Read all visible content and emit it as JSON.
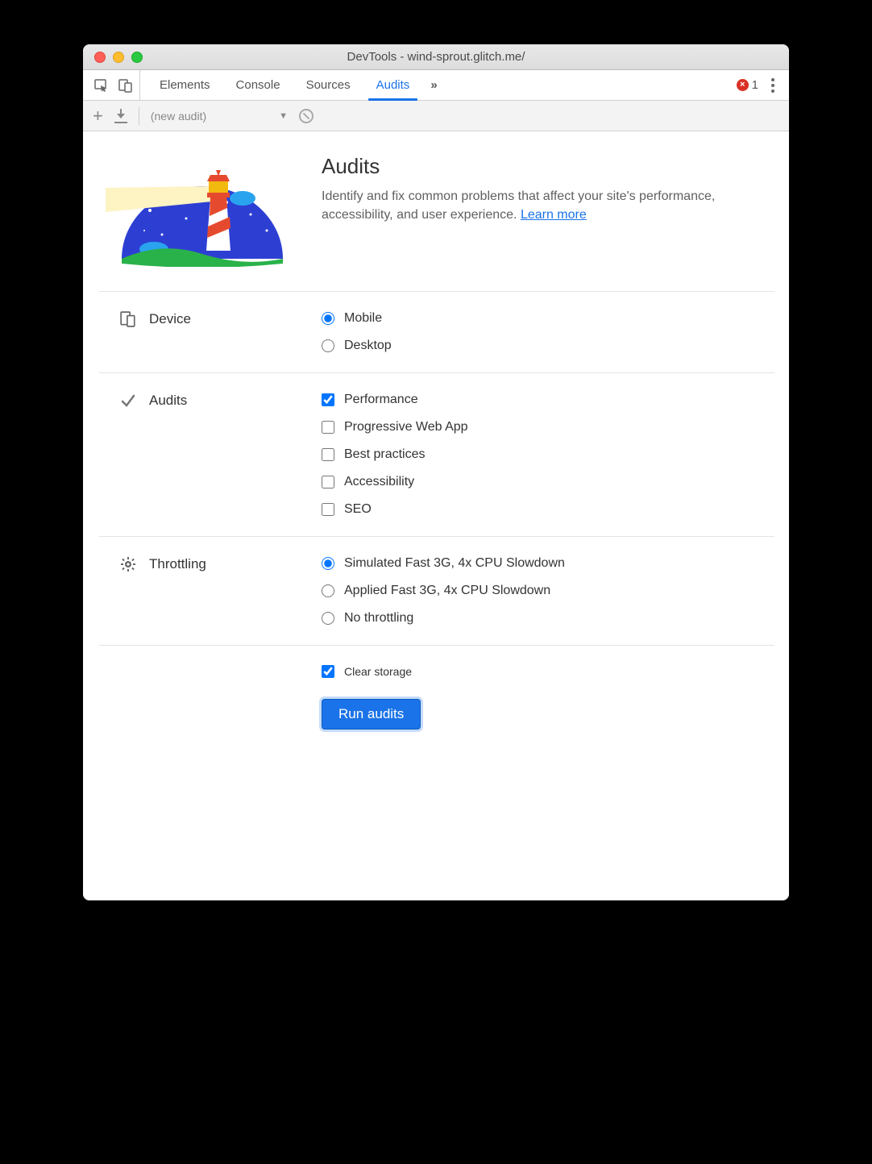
{
  "window": {
    "title": "DevTools - wind-sprout.glitch.me/"
  },
  "tabs": {
    "items": [
      {
        "label": "Elements",
        "active": false
      },
      {
        "label": "Console",
        "active": false
      },
      {
        "label": "Sources",
        "active": false
      },
      {
        "label": "Audits",
        "active": true
      }
    ],
    "errors_count": "1"
  },
  "subbar": {
    "dropdown_label": "(new audit)"
  },
  "intro": {
    "title": "Audits",
    "desc_prefix": "Identify and fix common problems that affect your site's performance, accessibility, and user experience. ",
    "learn_more": "Learn more"
  },
  "sections": {
    "device": {
      "title": "Device",
      "options": [
        {
          "label": "Mobile",
          "checked": true
        },
        {
          "label": "Desktop",
          "checked": false
        }
      ]
    },
    "audits": {
      "title": "Audits",
      "options": [
        {
          "label": "Performance",
          "checked": true
        },
        {
          "label": "Progressive Web App",
          "checked": false
        },
        {
          "label": "Best practices",
          "checked": false
        },
        {
          "label": "Accessibility",
          "checked": false
        },
        {
          "label": "SEO",
          "checked": false
        }
      ]
    },
    "throttling": {
      "title": "Throttling",
      "options": [
        {
          "label": "Simulated Fast 3G, 4x CPU Slowdown",
          "checked": true
        },
        {
          "label": "Applied Fast 3G, 4x CPU Slowdown",
          "checked": false
        },
        {
          "label": "No throttling",
          "checked": false
        }
      ]
    }
  },
  "footer": {
    "clear_storage": {
      "label": "Clear storage",
      "checked": true
    },
    "run_button": "Run audits"
  }
}
